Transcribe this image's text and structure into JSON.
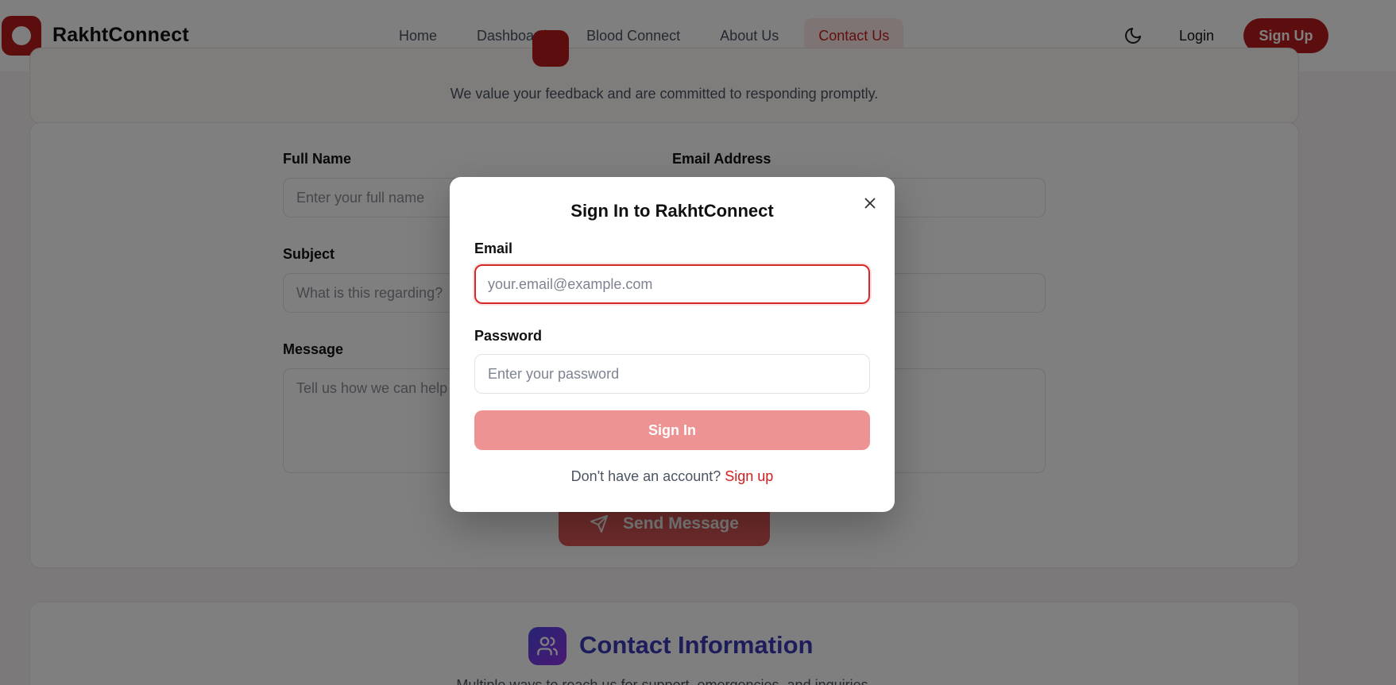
{
  "nav": {
    "brand": "RakhtConnect",
    "links": [
      {
        "label": "Home"
      },
      {
        "label": "Dashboard"
      },
      {
        "label": "Blood Connect"
      },
      {
        "label": "About Us"
      },
      {
        "label": "Contact Us",
        "active": true
      }
    ],
    "theme_icon": "moon-icon",
    "login": "Login",
    "signup": "Sign Up"
  },
  "page": {
    "hero_subtitle": "We value your feedback and are committed to responding promptly.",
    "form": {
      "full_name_label": "Full Name",
      "full_name_placeholder": "Enter your full name",
      "email_label": "Email Address",
      "subject_label": "Subject",
      "subject_placeholder": "What is this regarding?",
      "message_label": "Message",
      "message_placeholder": "Tell us how we can help",
      "send_button": "Send Message"
    },
    "contact_info": {
      "title": "Contact Information",
      "subtitle": "Multiple ways to reach us for support, emergencies, and inquiries."
    }
  },
  "modal": {
    "title": "Sign In to RakhtConnect",
    "email_label": "Email",
    "email_placeholder": "your.email@example.com",
    "email_value": "",
    "password_label": "Password",
    "password_placeholder": "Enter your password",
    "submit": "Sign In",
    "footer_text": "Don't have an account?",
    "footer_link": "Sign up"
  },
  "colors": {
    "brand": "#b91c1c",
    "accent_link": "#d21f1f",
    "submit_disabled": "#ee9393",
    "info_title": "#3b3bb8"
  }
}
